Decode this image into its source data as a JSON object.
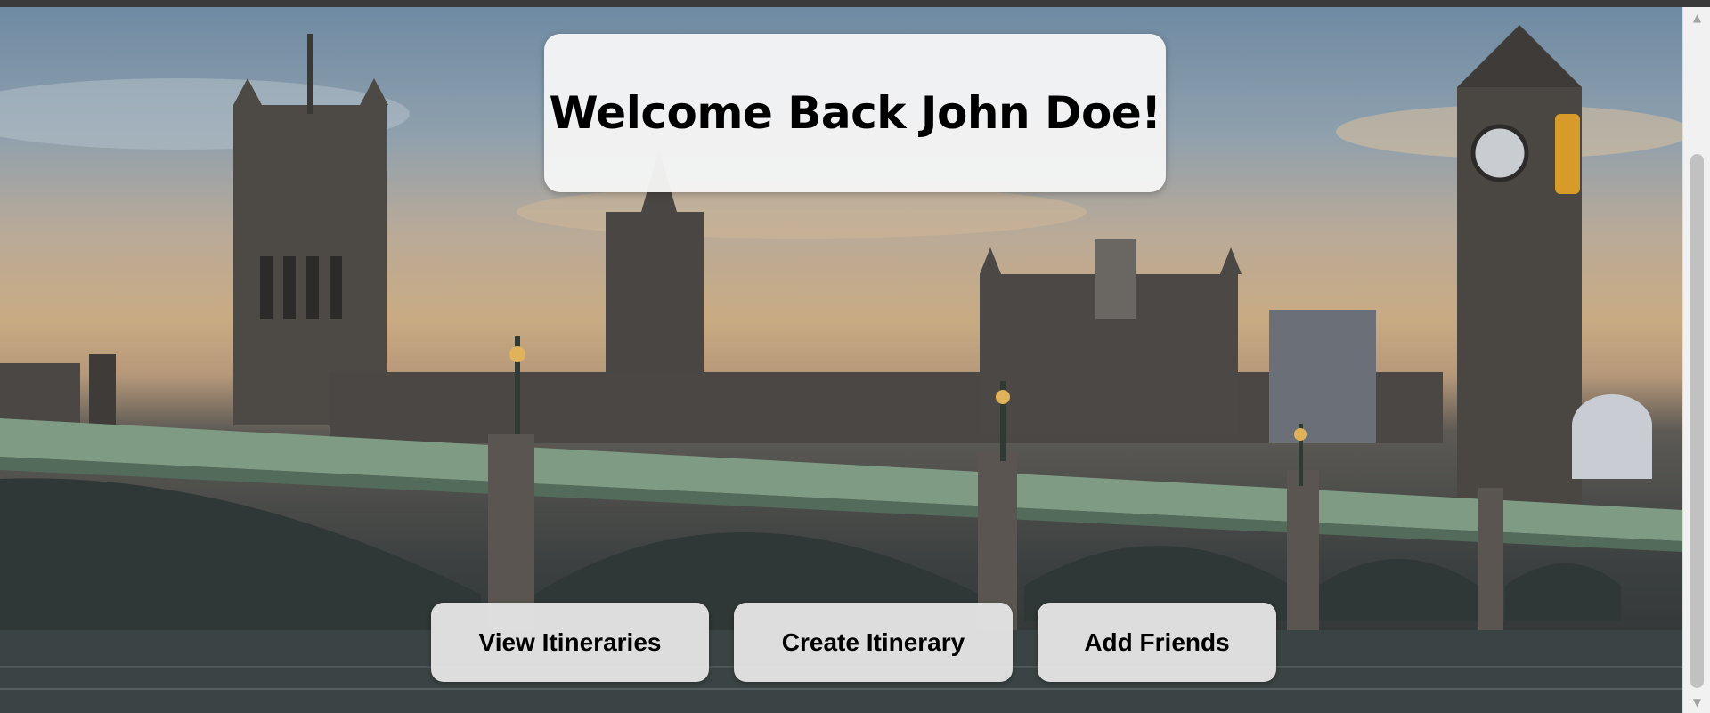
{
  "welcome": {
    "title": "Welcome Back John Doe!"
  },
  "actions": {
    "view_itineraries": "View Itineraries",
    "create_itinerary": "Create Itinerary",
    "add_friends": "Add Friends"
  },
  "background": {
    "scene": "london-westminster-bridge-photo"
  },
  "scrollbar": {
    "up_icon": "scroll-up-arrow-icon",
    "down_icon": "scroll-down-arrow-icon"
  },
  "colors": {
    "card_background": "#f5f5f5",
    "button_background": "#e4e4e4",
    "text": "#000000",
    "bridge_green": "#7f9b84"
  }
}
